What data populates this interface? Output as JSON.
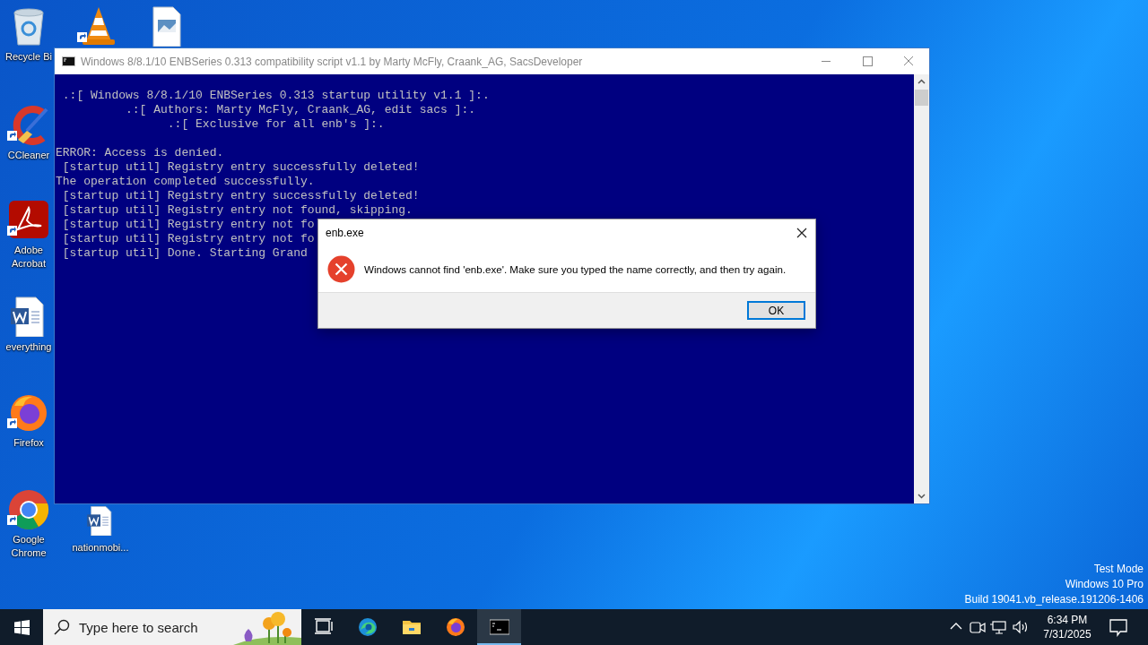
{
  "desktop": {
    "icons": [
      {
        "kind": "recycle-bin",
        "label": "Recycle Bi"
      },
      {
        "kind": "vlc"
      },
      {
        "kind": "image-file"
      },
      {
        "kind": "ccleaner",
        "label": "CCleaner"
      },
      {
        "kind": "acrobat",
        "label": "Adobe Acrobat"
      },
      {
        "kind": "word-doc",
        "label": "everything"
      },
      {
        "kind": "firefox",
        "label": "Firefox"
      },
      {
        "kind": "chrome",
        "label": "Google Chrome"
      },
      {
        "kind": "word-doc",
        "label": "nationmobi..."
      }
    ],
    "edition_text": [
      "Test Mode",
      "Windows 10 Pro",
      "Build 19041.vb_release.191206-1406"
    ]
  },
  "console_window": {
    "title": "Windows 8/8.1/10 ENBSeries 0.313 compatibility script v1.1 by Marty McFly, Craank_AG, SacsDeveloper",
    "active": false,
    "header_lines": [
      " .:[ Windows 8/8.1/10 ENBSeries 0.313 startup utility v1.1 ]:.",
      "          .:[ Authors: Marty McFly, Craank_AG, edit sacs ]:.",
      "                .:[ Exclusive for all enb's ]:."
    ],
    "output_lines": [
      "ERROR: Access is denied.",
      " [startup util] Registry entry successfully deleted!",
      "The operation completed successfully.",
      " [startup util] Registry entry successfully deleted!",
      " [startup util] Registry entry not found, skipping.",
      " [startup util] Registry entry not fo",
      " [startup util] Registry entry not fo",
      " [startup util] Done. Starting Grand"
    ]
  },
  "dialog": {
    "title": "enb.exe",
    "message": "Windows cannot find 'enb.exe'. Make sure you typed the name correctly, and then try again.",
    "button": "OK"
  },
  "taskbar": {
    "search": {
      "placeholder": "Type here to search"
    },
    "apps": [
      {
        "kind": "task-view",
        "active": false
      },
      {
        "kind": "edge",
        "active": false
      },
      {
        "kind": "explorer",
        "active": false
      },
      {
        "kind": "firefox",
        "active": false
      },
      {
        "kind": "console",
        "active": true
      }
    ],
    "clock": {
      "time": "6:34 PM",
      "date": "7/31/2025"
    }
  }
}
